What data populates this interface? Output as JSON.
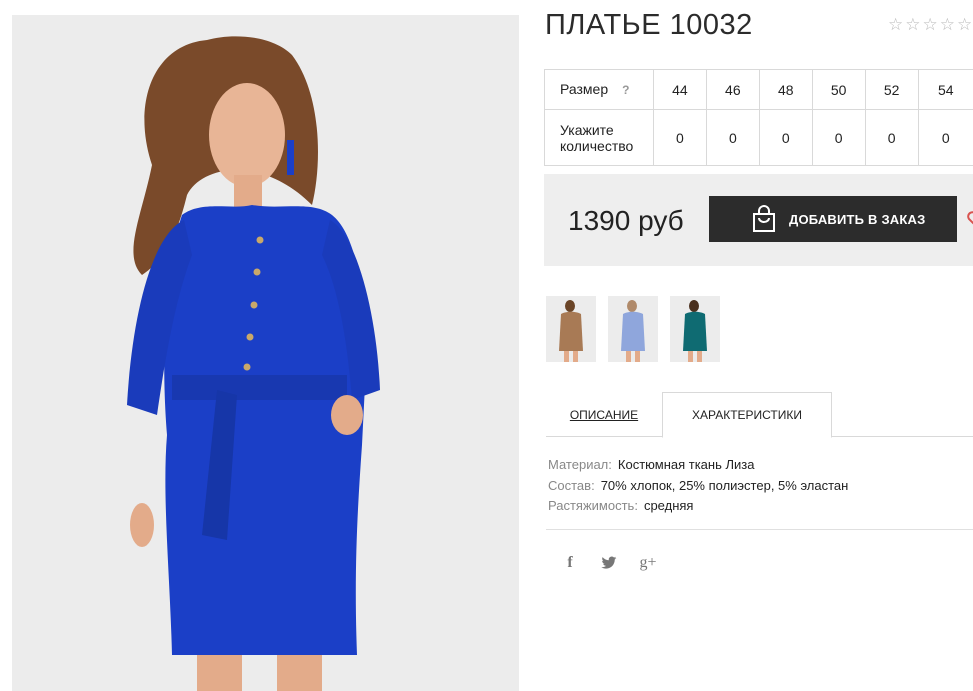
{
  "product": {
    "title": "ПЛАТЬЕ 10032",
    "rating_stars": 5,
    "rating_filled": 0
  },
  "sizes": {
    "size_label": "Размер",
    "help_mark": "?",
    "qty_label": "Укажите количество",
    "values": [
      "44",
      "46",
      "48",
      "50",
      "52",
      "54"
    ],
    "quantities": [
      "0",
      "0",
      "0",
      "0",
      "0",
      "0"
    ]
  },
  "order": {
    "price": "1390 руб",
    "add_button": "ДОБАВИТЬ В ЗАКАЗ"
  },
  "thumbnails": [
    {
      "name": "beige",
      "color": "#a87a55"
    },
    {
      "name": "light-blue",
      "color": "#8fa6dc"
    },
    {
      "name": "teal",
      "color": "#0f6b72"
    }
  ],
  "tabs": {
    "description": "ОПИСАНИЕ",
    "characteristics": "ХАРАКТЕРИСТИКИ"
  },
  "characteristics": [
    {
      "key": "Материал:",
      "value": "Костюмная ткань Лиза"
    },
    {
      "key": "Состав:",
      "value": "70% хлопок, 25% полиэстер, 5% эластан"
    },
    {
      "key": "Растяжимость:",
      "value": "средняя"
    }
  ],
  "social": {
    "facebook": "f",
    "twitter": "twitter-icon",
    "googleplus": "g+"
  },
  "colors": {
    "dress": "#1b3fc7",
    "button_bg": "#2c2c2c",
    "price_bg": "#eeeeee"
  }
}
